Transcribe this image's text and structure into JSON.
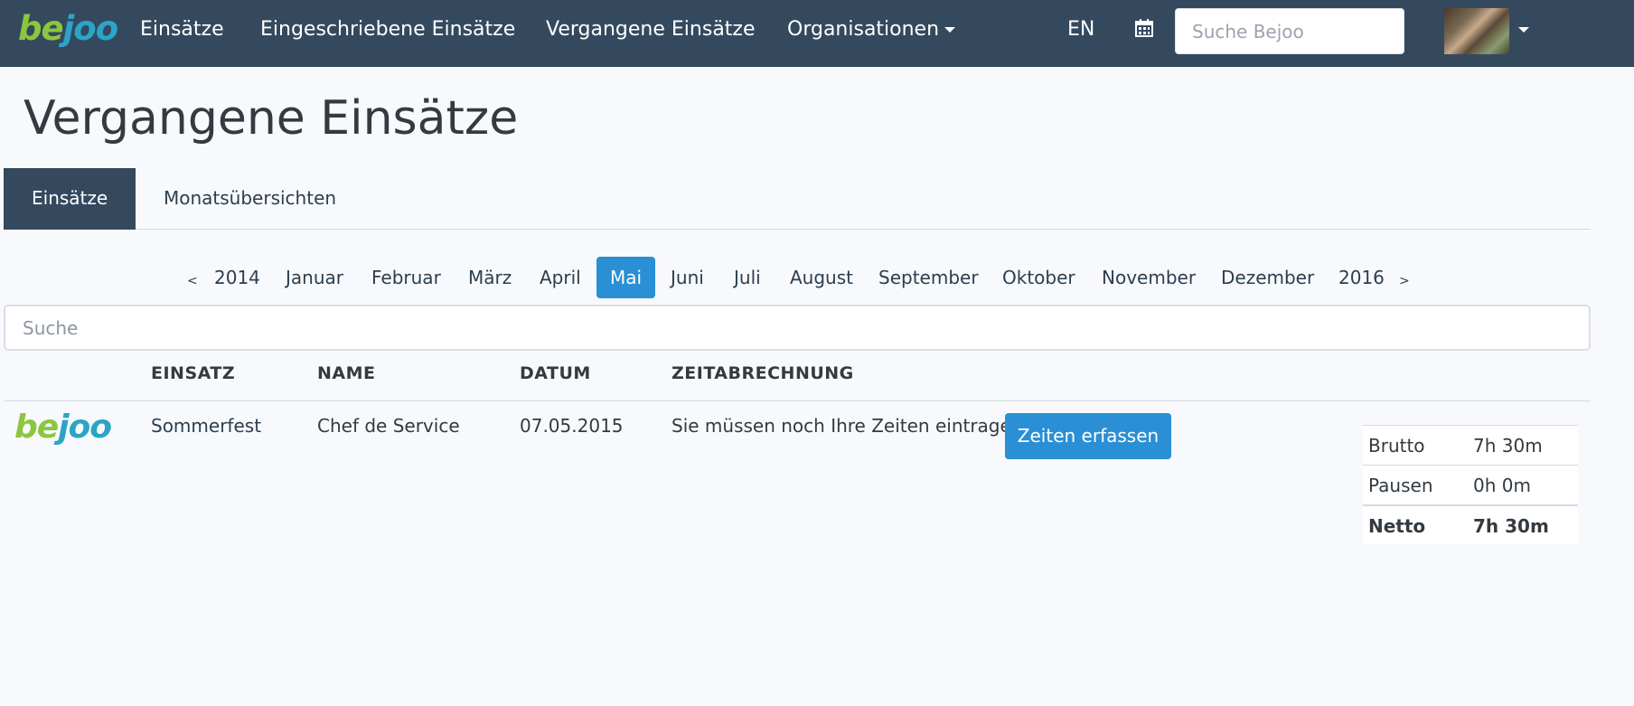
{
  "navbar": {
    "brand_be": "be",
    "brand_joo": "joo",
    "links": [
      "Einsätze",
      "Eingeschriebene Einsätze",
      "Vergangene Einsätze",
      "Organisationen"
    ],
    "lang": "EN",
    "search_placeholder": "Suche Bejoo"
  },
  "page": {
    "title": "Vergangene Einsätze"
  },
  "tabs": [
    "Einsätze",
    "Monatsübersichten"
  ],
  "pager": {
    "prev": "<",
    "next": ">",
    "items": [
      "2014",
      "Januar",
      "Februar",
      "März",
      "April",
      "Mai",
      "Juni",
      "Juli",
      "August",
      "September",
      "Oktober",
      "November",
      "Dezember",
      "2016"
    ],
    "active": "Mai"
  },
  "search": {
    "placeholder": "Suche"
  },
  "table": {
    "headers": [
      "EINSATZ",
      "NAME",
      "DATUM",
      "ZEITABRECHNUNG"
    ],
    "rows": [
      {
        "logo_be": "be",
        "logo_joo": "joo",
        "einsatz": "Sommerfest",
        "name": "Chef de Service",
        "datum": "07.05.2015",
        "zeit_msg": "Sie müssen noch Ihre Zeiten eintragen",
        "button": "Zeiten erfassen"
      }
    ]
  },
  "summary": [
    {
      "label": "Brutto",
      "value": "7h 30m"
    },
    {
      "label": "Pausen",
      "value": "0h 0m"
    },
    {
      "label": "Netto",
      "value": "7h 30m"
    }
  ],
  "colors": {
    "navbar": "#34495e",
    "accent": "#2a8fd4",
    "brand_green": "#8cc63f",
    "brand_blue": "#2aa5c8"
  },
  "icons": [
    "calendar-icon",
    "caret-down-icon"
  ]
}
